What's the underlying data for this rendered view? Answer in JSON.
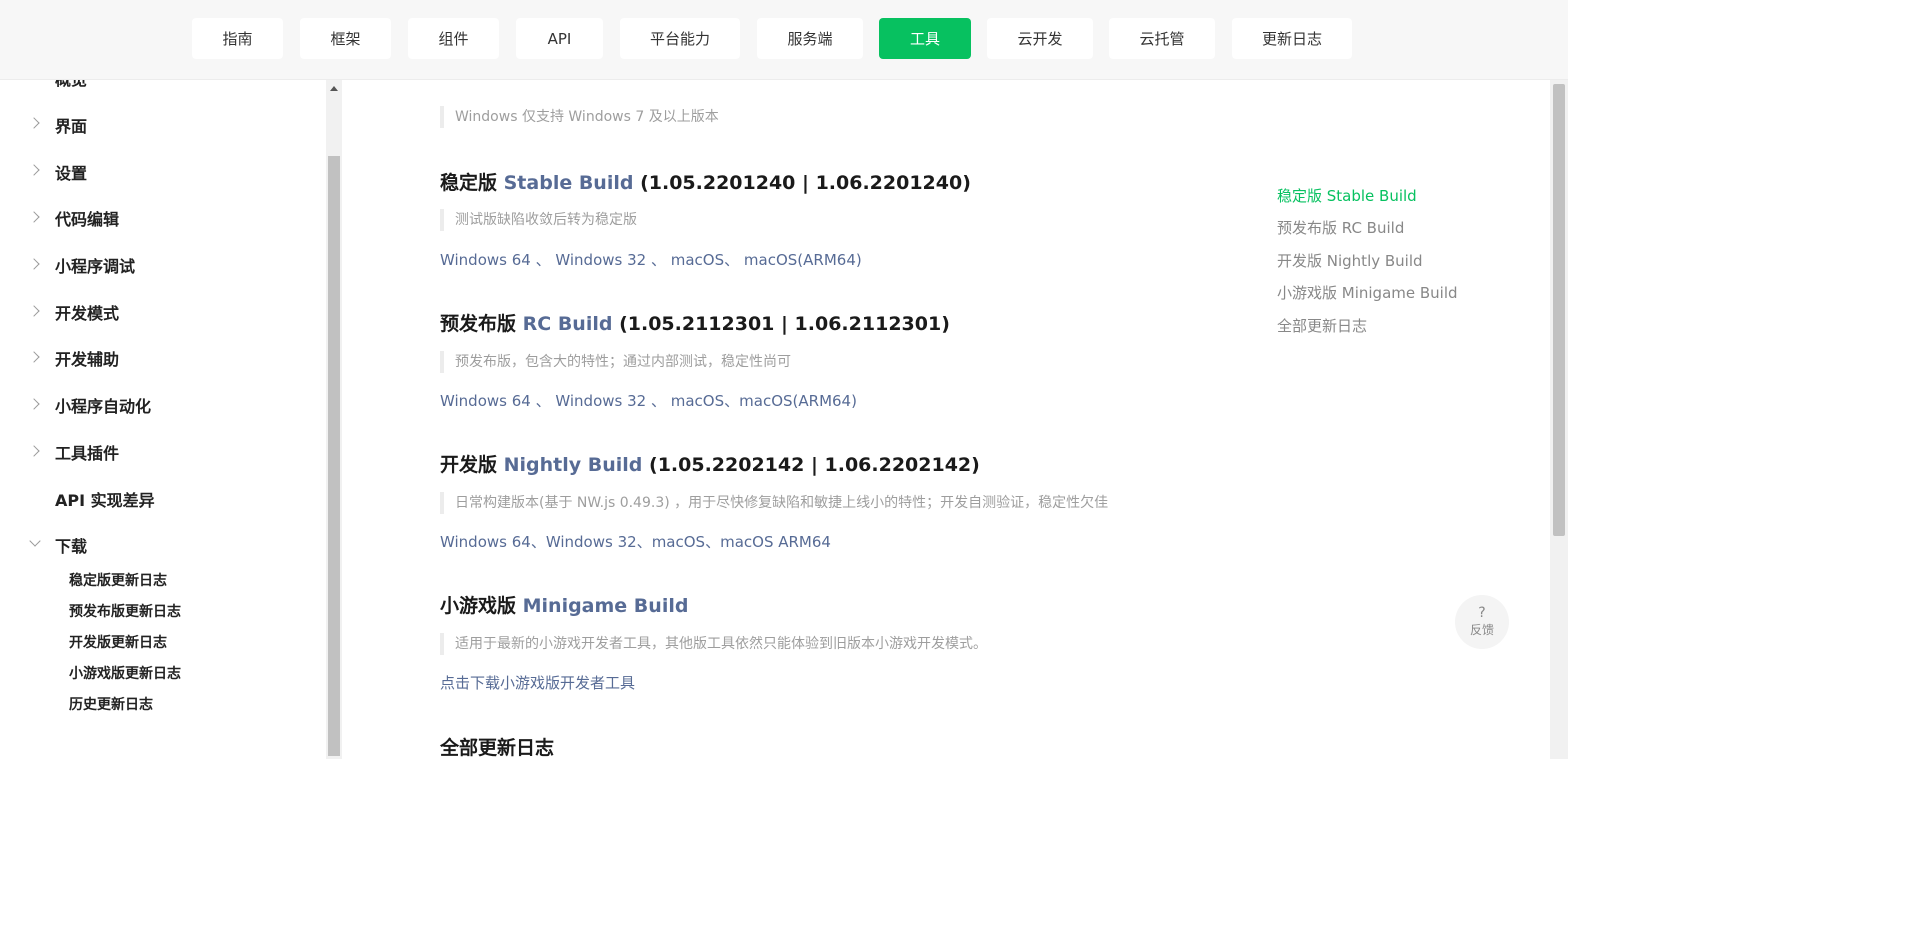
{
  "nav": {
    "items": [
      {
        "label": "指南"
      },
      {
        "label": "框架"
      },
      {
        "label": "组件"
      },
      {
        "label": "API"
      },
      {
        "label": "平台能力"
      },
      {
        "label": "服务端"
      },
      {
        "label": "工具",
        "active": true
      },
      {
        "label": "云开发"
      },
      {
        "label": "云托管"
      },
      {
        "label": "更新日志"
      }
    ]
  },
  "sidebar": {
    "cut_item": "概览",
    "items": [
      {
        "label": "界面"
      },
      {
        "label": "设置"
      },
      {
        "label": "代码编辑"
      },
      {
        "label": "小程序调试"
      },
      {
        "label": "开发模式"
      },
      {
        "label": "开发辅助"
      },
      {
        "label": "小程序自动化"
      },
      {
        "label": "工具插件"
      },
      {
        "label": "API 实现差异"
      },
      {
        "label": "下载"
      }
    ],
    "sub_items": [
      {
        "label": "稳定版更新日志"
      },
      {
        "label": "预发布版更新日志"
      },
      {
        "label": "开发版更新日志"
      },
      {
        "label": "小游戏版更新日志"
      },
      {
        "label": "历史更新日志"
      }
    ]
  },
  "main": {
    "windows_note": "Windows 仅支持 Windows 7 及以上版本",
    "stable": {
      "title_cn": "稳定版 ",
      "title_en": "Stable Build",
      "version": " (1.05.2201240 | 1.06.2201240)",
      "note": "测试版缺陷收敛后转为稳定版",
      "links": [
        "Windows 64",
        "Windows 32",
        "macOS",
        "macOS(ARM64)"
      ],
      "seps": [
        " 、 ",
        " 、 ",
        "、 "
      ]
    },
    "rc": {
      "title_cn": "预发布版 ",
      "title_en": "RC Build",
      "version": " (1.05.2112301 | 1.06.2112301)",
      "note": "预发布版，包含大的特性；通过内部测试，稳定性尚可",
      "links": [
        "Windows 64",
        "Windows 32",
        "macOS",
        "macOS(ARM64)"
      ],
      "seps": [
        " 、 ",
        " 、 ",
        "、"
      ]
    },
    "nightly": {
      "title_cn": "开发版 ",
      "title_en": "Nightly Build",
      "version": " (1.05.2202142 | 1.06.2202142)",
      "note": "日常构建版本(基于 NW.js 0.49.3) ，用于尽快修复缺陷和敏捷上线小的特性；开发自测验证，稳定性欠佳",
      "links": [
        "Windows 64",
        "Windows 32",
        "macOS",
        "macOS ARM64"
      ],
      "seps": [
        "、",
        "、",
        "、"
      ]
    },
    "minigame": {
      "title_cn": "小游戏版 ",
      "title_en": "Minigame Build",
      "note": "适用于最新的小游戏开发者工具，其他版工具依然只能体验到旧版本小游戏开发模式。",
      "link": "点击下载小游戏版开发者工具"
    },
    "all_logs_title": "全部更新日志"
  },
  "toc": [
    {
      "label": "稳定版 Stable Build",
      "active": true
    },
    {
      "label": "预发布版 RC Build"
    },
    {
      "label": "开发版 Nightly Build"
    },
    {
      "label": "小游戏版 Minigame Build"
    },
    {
      "label": "全部更新日志"
    }
  ],
  "feedback": {
    "icon_glyph": "?",
    "label": "反馈"
  },
  "colors": {
    "accent": "#07c160",
    "link": "#576b95"
  }
}
